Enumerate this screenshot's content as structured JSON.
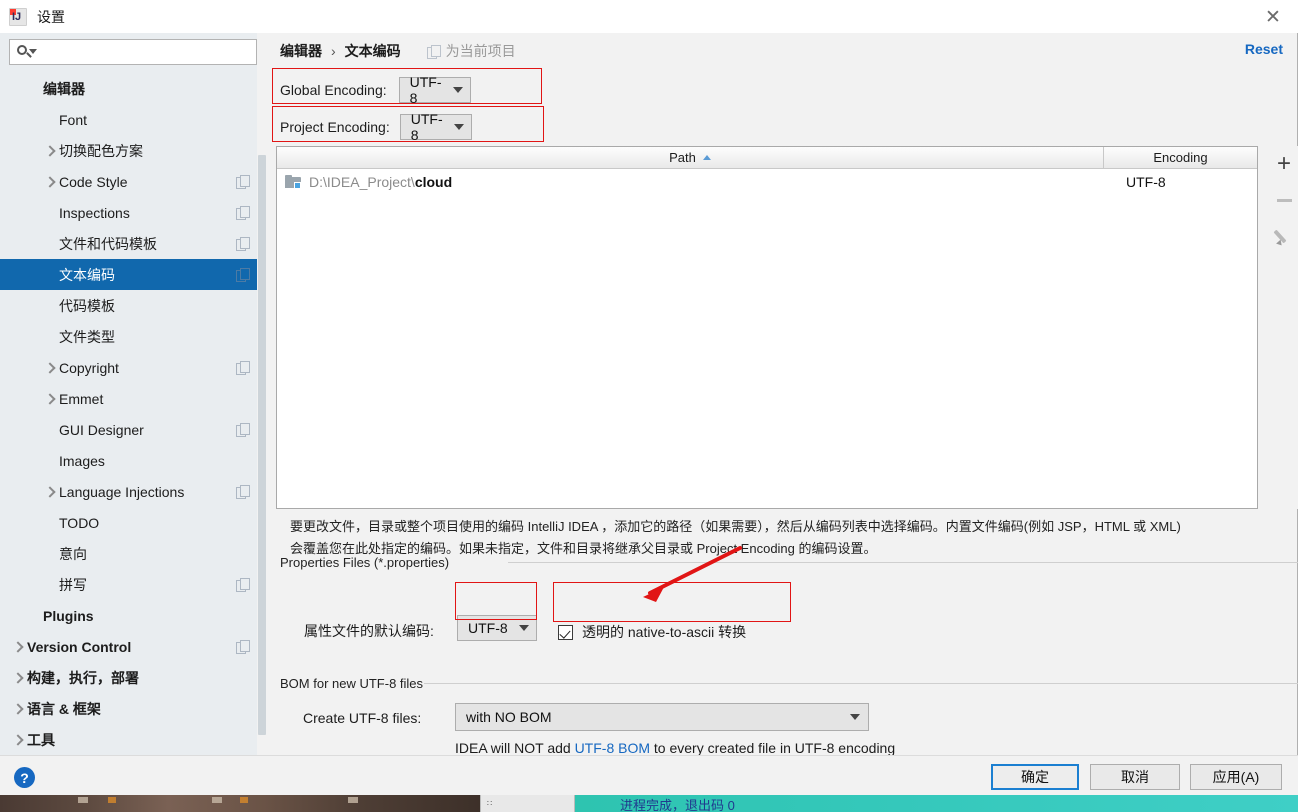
{
  "window": {
    "title": "设置",
    "app_icon": "intellij-idea-icon",
    "close_label": "✕"
  },
  "search": {
    "value": "",
    "placeholder": ""
  },
  "sidebar": {
    "items": [
      {
        "label": "编辑器",
        "indent": 1,
        "expandable": false,
        "bold": true,
        "copy": false,
        "selected": false
      },
      {
        "label": "Font",
        "indent": 2,
        "expandable": false,
        "bold": false,
        "copy": false,
        "selected": false
      },
      {
        "label": "切换配色方案",
        "indent": 2,
        "expandable": true,
        "bold": false,
        "copy": false,
        "selected": false
      },
      {
        "label": "Code Style",
        "indent": 2,
        "expandable": true,
        "bold": false,
        "copy": true,
        "selected": false
      },
      {
        "label": "Inspections",
        "indent": 2,
        "expandable": false,
        "bold": false,
        "copy": true,
        "selected": false
      },
      {
        "label": "文件和代码模板",
        "indent": 2,
        "expandable": false,
        "bold": false,
        "copy": true,
        "selected": false
      },
      {
        "label": "文本编码",
        "indent": 2,
        "expandable": false,
        "bold": false,
        "copy": true,
        "selected": true
      },
      {
        "label": "代码模板",
        "indent": 2,
        "expandable": false,
        "bold": false,
        "copy": false,
        "selected": false
      },
      {
        "label": "文件类型",
        "indent": 2,
        "expandable": false,
        "bold": false,
        "copy": false,
        "selected": false
      },
      {
        "label": "Copyright",
        "indent": 2,
        "expandable": true,
        "bold": false,
        "copy": true,
        "selected": false
      },
      {
        "label": "Emmet",
        "indent": 2,
        "expandable": true,
        "bold": false,
        "copy": false,
        "selected": false
      },
      {
        "label": "GUI Designer",
        "indent": 2,
        "expandable": false,
        "bold": false,
        "copy": true,
        "selected": false
      },
      {
        "label": "Images",
        "indent": 2,
        "expandable": false,
        "bold": false,
        "copy": false,
        "selected": false
      },
      {
        "label": "Language Injections",
        "indent": 2,
        "expandable": true,
        "bold": false,
        "copy": true,
        "selected": false
      },
      {
        "label": "TODO",
        "indent": 2,
        "expandable": false,
        "bold": false,
        "copy": false,
        "selected": false
      },
      {
        "label": "意向",
        "indent": 2,
        "expandable": false,
        "bold": false,
        "copy": false,
        "selected": false
      },
      {
        "label": "拼写",
        "indent": 2,
        "expandable": false,
        "bold": false,
        "copy": true,
        "selected": false
      },
      {
        "label": "Plugins",
        "indent": 1,
        "expandable": false,
        "bold": true,
        "copy": false,
        "selected": false
      },
      {
        "label": "Version Control",
        "indent": 0,
        "expandable": true,
        "bold": true,
        "copy": true,
        "selected": false
      },
      {
        "label": "构建，执行，部署",
        "indent": 0,
        "expandable": true,
        "bold": true,
        "copy": false,
        "selected": false
      },
      {
        "label": "语言 & 框架",
        "indent": 0,
        "expandable": true,
        "bold": true,
        "copy": false,
        "selected": false
      },
      {
        "label": "工具",
        "indent": 0,
        "expandable": true,
        "bold": true,
        "copy": false,
        "selected": false
      }
    ]
  },
  "header": {
    "breadcrumb_root": "编辑器",
    "breadcrumb_sep": "›",
    "breadcrumb_leaf": "文本编码",
    "for_project_label": "为当前项目",
    "reset_label": "Reset"
  },
  "encoding": {
    "global_label": "Global Encoding:",
    "global_value": "UTF-8",
    "project_label": "Project Encoding:",
    "project_value": "UTF-8"
  },
  "table": {
    "columns": [
      "Path",
      "Encoding"
    ],
    "sort_column": "Path",
    "sort_direction": "asc",
    "rows": [
      {
        "path_prefix": "D:\\IDEA_Project\\",
        "path_name": "cloud",
        "encoding": "UTF-8"
      }
    ],
    "tools": {
      "add": "+",
      "remove": "−",
      "edit": "edit-pencil"
    }
  },
  "description": {
    "line1": "要更改文件，目录或整个项目使用的编码 IntelliJ IDEA ，添加它的路径（如果需要），然后从编码列表中选择编码。内置文件编码(例如 JSP，HTML 或 XML)",
    "line2": "会覆盖您在此处指定的编码。如果未指定，文件和目录将继承父目录或 Project Encoding 的编码设置。"
  },
  "properties_section": {
    "title": "Properties Files (*.properties)",
    "default_encoding_label": "属性文件的默认编码:",
    "default_encoding_value": "UTF-8",
    "transparent_checkbox_label": "透明的 native-to-ascii 转换",
    "transparent_checkbox_checked": true
  },
  "bom_section": {
    "title": "BOM for new UTF-8 files",
    "create_label": "Create UTF-8 files:",
    "create_value": "with NO BOM",
    "note_prefix": "IDEA will NOT add ",
    "note_link": "UTF-8 BOM",
    "note_suffix": " to every created file in UTF-8 encoding"
  },
  "footer": {
    "help": "?",
    "ok": "确定",
    "cancel": "取消",
    "apply": "应用(A)"
  },
  "background": {
    "terminal_text": "进程完成，退出码 0"
  },
  "colors": {
    "accent_selection": "#1168ad",
    "link": "#1668c1",
    "annotation_red": "#e11515",
    "panel_bg": "#f2f2f2",
    "sidebar_bg": "#e9edf0",
    "terminal_bg": "#2ec4b0"
  }
}
